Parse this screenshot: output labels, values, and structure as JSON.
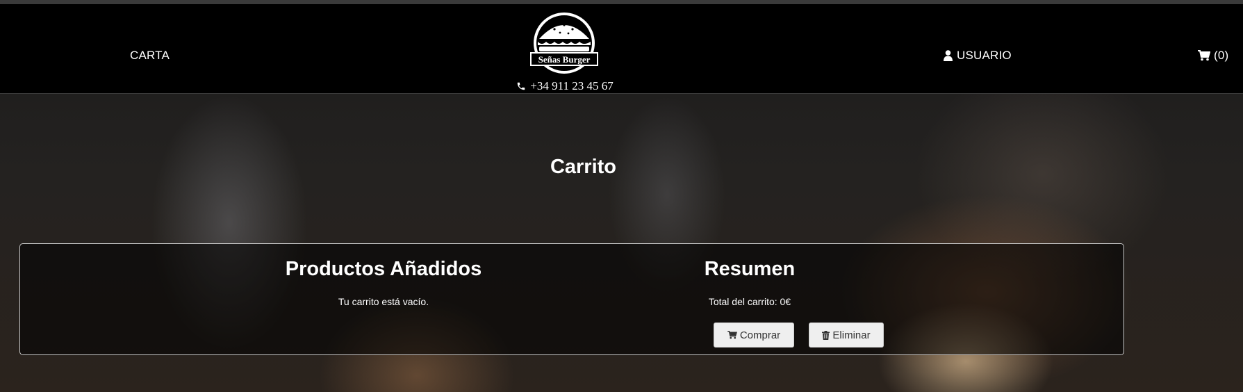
{
  "nav": {
    "carta": "CARTA",
    "usuario": "USUARIO",
    "cart_count": "(0)",
    "phone": "+34 911 23 45 67"
  },
  "logo": {
    "text": "Señas Burger"
  },
  "page": {
    "title": "Carrito"
  },
  "products": {
    "title": "Productos Añadidos",
    "empty_message": "Tu carrito está vacío."
  },
  "summary": {
    "title": "Resumen",
    "total": "Total del carrito: 0€",
    "buy_label": "Comprar",
    "delete_label": "Eliminar"
  },
  "colors": {
    "header_bg": "#000000",
    "button_bg": "#efefef",
    "panel_border": "#c9c9c9"
  }
}
